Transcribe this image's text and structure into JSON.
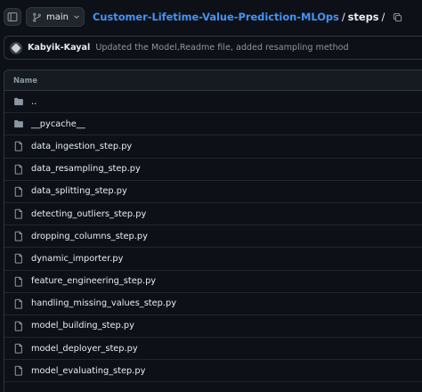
{
  "header": {
    "branch": "main",
    "breadcrumb": {
      "repo": "Customer-Lifetime-Value-Prediction-MLOps",
      "separator": "/",
      "current_dir": "steps",
      "trailing_separator": "/"
    }
  },
  "latest_commit": {
    "author": "Kabyik-Kayal",
    "message": "Updated the Model,Readme file, added resampling method"
  },
  "file_table": {
    "column_header": "Name",
    "rows": [
      {
        "name": "..",
        "type": "parent-directory",
        "icon": "folder-icon"
      },
      {
        "name": "__pycache__",
        "type": "directory",
        "icon": "folder-icon"
      },
      {
        "name": "data_ingestion_step.py",
        "type": "file",
        "icon": "file-icon"
      },
      {
        "name": "data_resampling_step.py",
        "type": "file",
        "icon": "file-icon"
      },
      {
        "name": "data_splitting_step.py",
        "type": "file",
        "icon": "file-icon"
      },
      {
        "name": "detecting_outliers_step.py",
        "type": "file",
        "icon": "file-icon"
      },
      {
        "name": "dropping_columns_step.py",
        "type": "file",
        "icon": "file-icon"
      },
      {
        "name": "dynamic_importer.py",
        "type": "file",
        "icon": "file-icon"
      },
      {
        "name": "feature_engineering_step.py",
        "type": "file",
        "icon": "file-icon"
      },
      {
        "name": "handling_missing_values_step.py",
        "type": "file",
        "icon": "file-icon"
      },
      {
        "name": "model_building_step.py",
        "type": "file",
        "icon": "file-icon"
      },
      {
        "name": "model_deployer_step.py",
        "type": "file",
        "icon": "file-icon"
      },
      {
        "name": "model_evaluating_step.py",
        "type": "file",
        "icon": "file-icon"
      }
    ]
  }
}
